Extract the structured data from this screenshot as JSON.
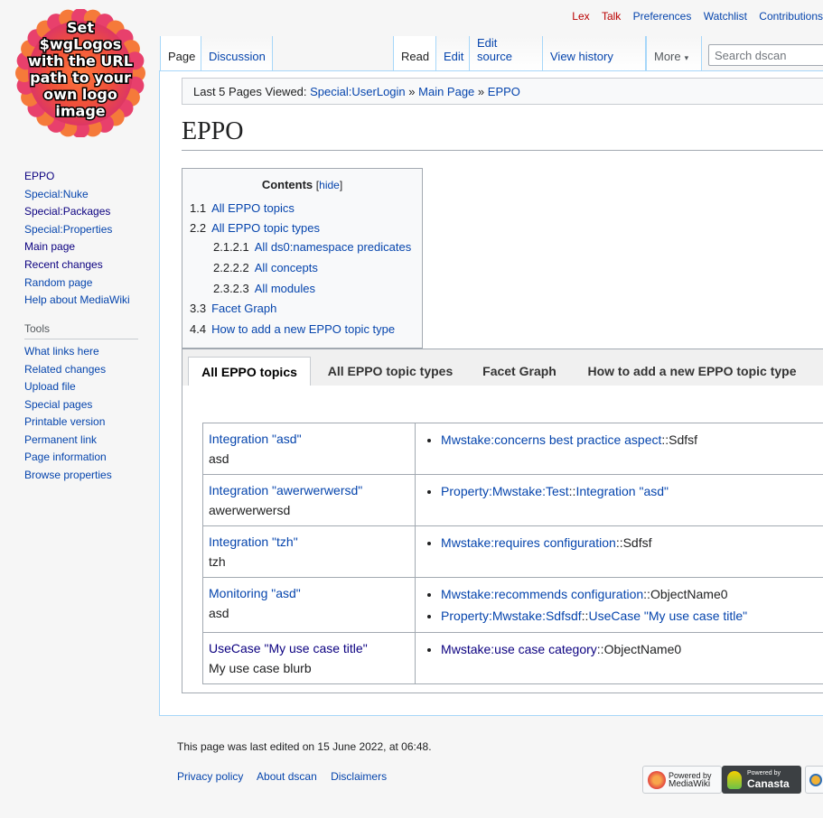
{
  "logo": {
    "lines": [
      "Set",
      "$wgLogos",
      "with the URL",
      "path to your",
      "own logo",
      "image"
    ]
  },
  "personal_tools": [
    "Lex",
    "Talk",
    "Preferences",
    "Watchlist",
    "Contributions"
  ],
  "namespace_tabs": [
    "Page",
    "Discussion"
  ],
  "view_tabs": [
    "Read",
    "Edit",
    "Edit source",
    "View history"
  ],
  "more_label": "More",
  "search": {
    "placeholder": "Search dscan"
  },
  "navigation": [
    "EPPO",
    "Special:Nuke",
    "Special:Packages",
    "Special:Properties",
    "Main page",
    "Recent changes",
    "Random page",
    "Help about MediaWiki"
  ],
  "tools": {
    "heading": "Tools",
    "items": [
      "What links here",
      "Related changes",
      "Upload file",
      "Special pages",
      "Printable version",
      "Permanent link",
      "Page information",
      "Browse properties"
    ]
  },
  "breadcrumbs": {
    "prefix": "Last 5 Pages Viewed:",
    "links": [
      "Special:UserLogin",
      "Main Page",
      "EPPO"
    ],
    "sep": "»"
  },
  "page_title": "EPPO",
  "toc": {
    "title": "Contents",
    "hide_label": "hide",
    "items": [
      {
        "num": "1.1",
        "label": "All EPPO topics"
      },
      {
        "num": "2.2",
        "label": "All EPPO topic types"
      },
      {
        "num": "2.1.2.1",
        "label": "All ds0:namespace predicates"
      },
      {
        "num": "2.2.2.2",
        "label": "All concepts"
      },
      {
        "num": "2.3.2.3",
        "label": "All modules"
      },
      {
        "num": "3.3",
        "label": "Facet Graph"
      },
      {
        "num": "4.4",
        "label": "How to add a new EPPO topic type"
      }
    ]
  },
  "widget_tabs": [
    "All EPPO topics",
    "All EPPO topic types",
    "Facet Graph",
    "How to add a new EPPO topic type"
  ],
  "rows": [
    {
      "title": "Integration \"asd\"",
      "desc": "asd",
      "props": [
        {
          "link": "Mwstake:concerns best practice aspect",
          "sep": "::",
          "value": "Sdfsf",
          "value_link": false
        }
      ]
    },
    {
      "title": "Integration \"awerwerwersd\"",
      "desc": "awerwerwersd",
      "props": [
        {
          "link": "Property:Mwstake:Test",
          "sep": "::",
          "value": "Integration \"asd\"",
          "value_link": true
        }
      ]
    },
    {
      "title": "Integration \"tzh\"",
      "desc": "tzh",
      "props": [
        {
          "link": "Mwstake:requires configuration",
          "sep": "::",
          "value": "Sdfsf",
          "value_link": false
        }
      ]
    },
    {
      "title": "Monitoring \"asd\"",
      "desc": "asd",
      "props": [
        {
          "link": "Mwstake:recommends configuration",
          "sep": "::",
          "value": "ObjectName0",
          "value_link": false
        },
        {
          "link": "Property:Mwstake:Sdfsdf",
          "sep": "::",
          "value": "UseCase \"My use case title\"",
          "value_link": true
        }
      ]
    },
    {
      "title": "UseCase \"My use case title\"",
      "desc": "My use case blurb",
      "props": [
        {
          "link": "Mwstake:use case category",
          "sep": "::",
          "value": "ObjectName0",
          "value_link": false
        }
      ]
    }
  ],
  "footer": {
    "last_edited": "This page was last edited on 15 June 2022, at 06:48.",
    "links": [
      "Privacy policy",
      "About dscan",
      "Disclaimers"
    ],
    "badges": [
      {
        "line1": "Powered by",
        "line2": "MediaWiki"
      },
      {
        "line1": "Powered by",
        "line2": "Canasta"
      }
    ]
  }
}
